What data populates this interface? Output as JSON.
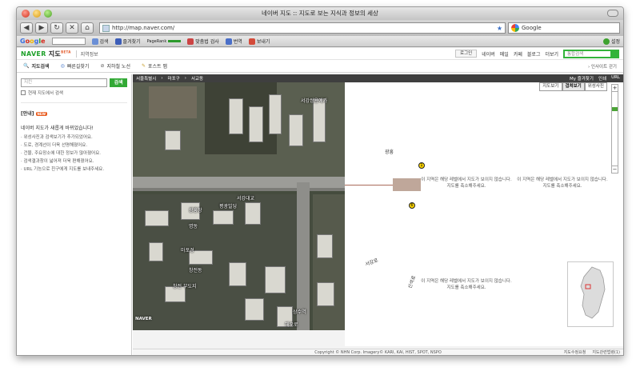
{
  "browser": {
    "window_title": "네이버 지도 :: 지도로 보는 지식과 정보의 세상",
    "url": "http://map.naver.com/",
    "search_engine": "Google",
    "google_toolbar_items": [
      "검색",
      "즐겨찾기",
      "PageRank",
      "맞춤법 검사",
      "번역",
      "보내기"
    ],
    "google_toolbar_settings": "설정"
  },
  "header": {
    "logo": "NAVER",
    "service": "지도",
    "beta": "BETA",
    "sub": "지역정보",
    "login": "로그인",
    "links": [
      "네이버",
      "메일",
      "카페",
      "블로그",
      "더보기"
    ],
    "search_placeholder": "통합검색"
  },
  "tabs": {
    "items": [
      "지도검색",
      "빠른길찾기",
      "지하철 노선",
      "포스트 맵"
    ],
    "right": "› 인사이트 걷기"
  },
  "sidebar": {
    "search_placeholder": "지킨",
    "search_button": "검색",
    "checkbox_label": "현재 지도에서 검색",
    "notice_title": "[안내]",
    "notice_badge": "NEW",
    "notice_head": "네이버 지도가 새롭게 바뀌었습니다!",
    "notice_items": [
      "위성사진과 검색보기가 추가되었어요.",
      "도로, 경계선이 더욱 선명해졌어요.",
      "건물, 주요장소에 대한 정보가 많아졌어요.",
      "검색결과창이 넓어져 더욱 편해졌어요.",
      "URL 기능으로 친구에게 지도를 보내주세요."
    ]
  },
  "map": {
    "breadcrumb": [
      "서울특별시",
      "마포구",
      "서교동"
    ],
    "controls": [
      "My 즐겨찾기",
      "인쇄",
      "URL"
    ],
    "view_modes": [
      "지도보기",
      "겹쳐보기",
      "위성사진"
    ],
    "active_view": "겹쳐보기",
    "zoom_plus": "+",
    "zoom_minus": "−",
    "satellite_labels": [
      "서강쌍용예가",
      "서강대교",
      "평광빌딩",
      "광흥창",
      "명동",
      "마포경",
      "창전동"
    ],
    "satellite_bottom_labels": [
      "창전 부도지",
      "상수역",
      "해오로"
    ],
    "map_labels": [
      "광흥",
      "서강로",
      "신석로"
    ],
    "no_image_text": "이 지역은 해당 레벨에서 지도가 보이지 않습니다.",
    "no_image_text2": "지도를 축소해주세요.",
    "poi_numbers": [
      "1",
      "6"
    ],
    "watermark": "NAVER",
    "footer_copyright": "Copyright © NHN Corp. Imagery© KARI, KAI, HIST, SPOT, NSPO",
    "footer_links": [
      "지도수정요청",
      "지도관련법령(1)"
    ]
  },
  "colors": {
    "naver_green": "#32b33a",
    "notice_badge": "#e85a1c",
    "map_bar": "#1e1e1e"
  }
}
